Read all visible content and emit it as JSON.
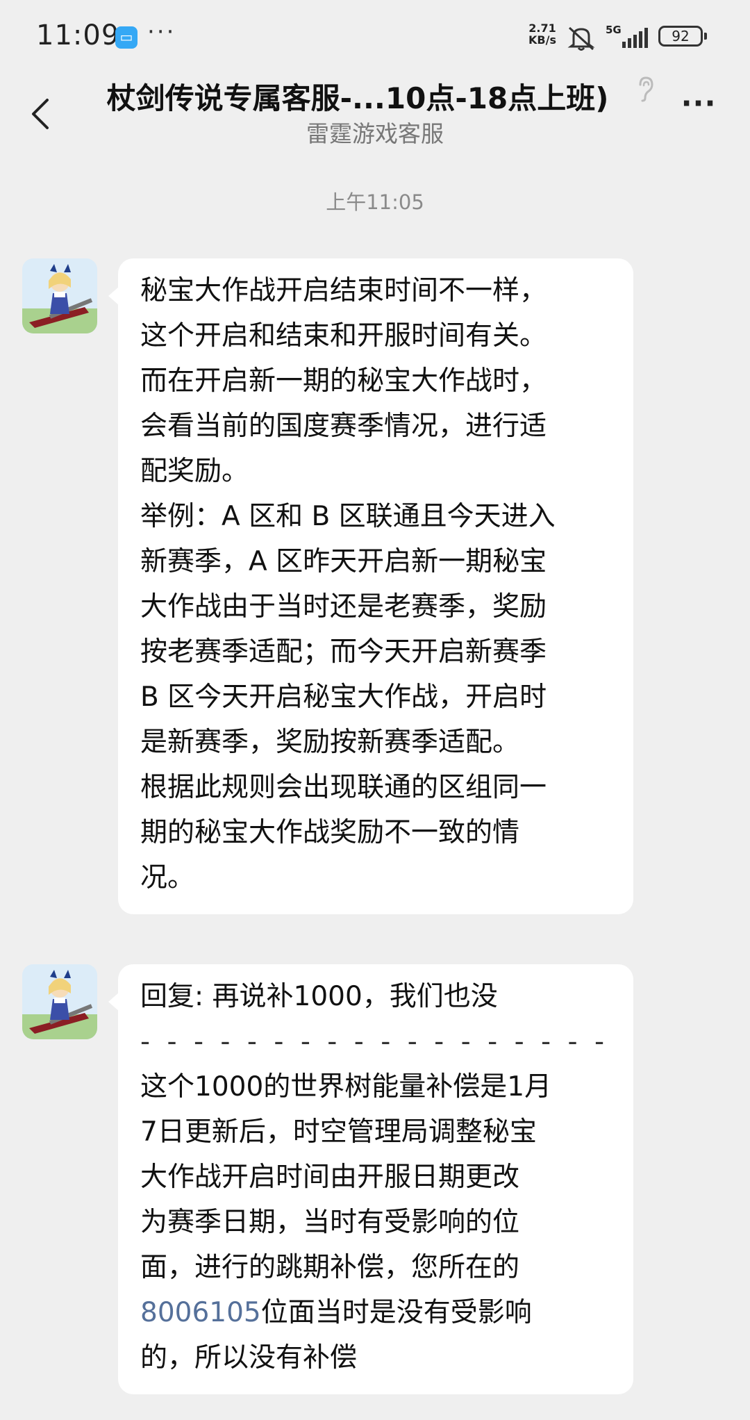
{
  "status_bar": {
    "time": "11:09",
    "app_icon": "qq-icon",
    "dots": "···",
    "net_speed_value": "2.71",
    "net_speed_unit": "KB/s",
    "network": "5G",
    "battery": "92"
  },
  "header": {
    "title": "杖剑传说专属客服-...10点-18点上班)",
    "subtitle": "雷霆游戏客服",
    "back_icon": "chevron-left-icon",
    "more_icon": "more-icon",
    "more_label": "···"
  },
  "timestamp": "上午11:05",
  "messages": [
    {
      "sender": "雷霆游戏客服",
      "lines": [
        "秘宝大作战开启结束时间不一样，",
        "这个开启和结束和开服时间有关。",
        "而在开启新一期的秘宝大作战时，",
        "会看当前的国度赛季情况，进行适",
        "配奖励。",
        "举例：A 区和 B 区联通且今天进入",
        "新赛季，A 区昨天开启新一期秘宝",
        "大作战由于当时还是老赛季，奖励",
        "按老赛季适配；而今天开启新赛季",
        "B 区今天开启秘宝大作战，开启时",
        "是新赛季，奖励按新赛季适配。",
        "根据此规则会出现联通的区组同一",
        "期的秘宝大作战奖励不一致的情",
        "况。"
      ]
    },
    {
      "sender": "雷霆游戏客服",
      "reply_line": "回复: 再说补1000，我们也没",
      "separator": "- - - - - - - - - - - - - - - - - -",
      "lines": [
        "这个1000的世界树能量补偿是1月",
        "7日更新后，时空管理局调整秘宝",
        "大作战开启时间由开服日期更改",
        "为赛季日期，当时有受影响的位",
        "面，进行的跳期补偿，您所在的"
      ],
      "link_number": "8006105",
      "link_line_rest": "位面当时是没有受影响",
      "last_line": "的，所以没有补偿"
    }
  ]
}
